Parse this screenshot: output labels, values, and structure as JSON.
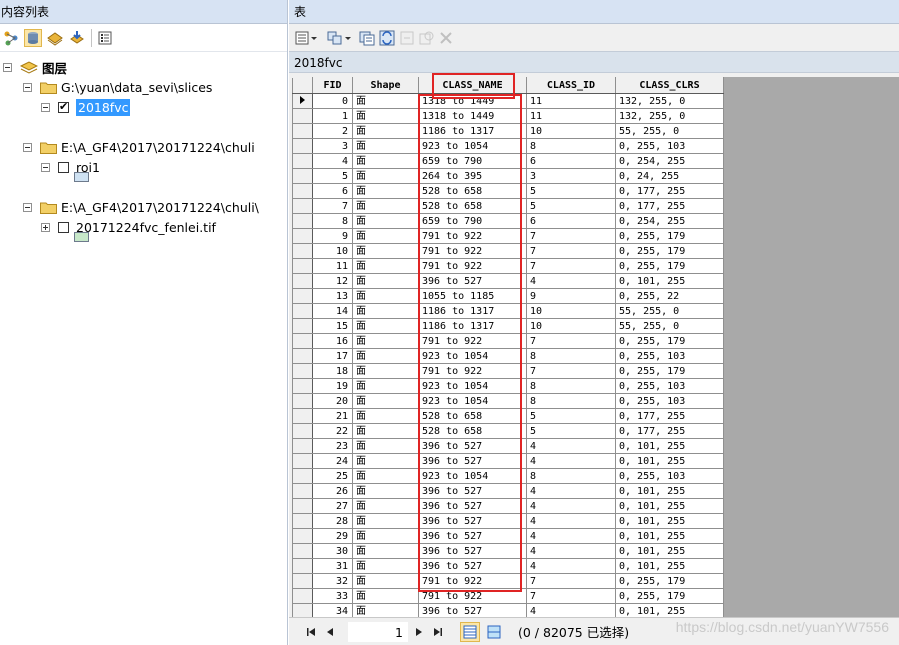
{
  "toc": {
    "title": "内容列表",
    "root_label": "图层",
    "items": [
      {
        "label": "G:\\yuan\\data_sevi\\slices",
        "children": [
          {
            "label": "2018fvc",
            "checked": true,
            "selected": true,
            "swatch": "#cfe2f3"
          }
        ]
      },
      {
        "label": "E:\\A_GF4\\2017\\20171224\\chuli",
        "children": [
          {
            "label": "roi1",
            "checked": false,
            "selected": false,
            "swatch": "#c7e8c9"
          }
        ]
      },
      {
        "label": "E:\\A_GF4\\2017\\20171224\\chuli\\",
        "children": [
          {
            "label": "20171224fvc_fenlei.tif",
            "checked": false,
            "selected": false
          }
        ]
      }
    ]
  },
  "table_window": {
    "title": "表",
    "table_name": "2018fvc",
    "columns": [
      "FID",
      "Shape",
      "CLASS_NAME",
      "CLASS_ID",
      "CLASS_CLRS"
    ],
    "rows": [
      [
        "0",
        "面",
        "1318 to 1449",
        "11",
        "132, 255, 0"
      ],
      [
        "1",
        "面",
        "1318 to 1449",
        "11",
        "132, 255, 0"
      ],
      [
        "2",
        "面",
        "1186 to 1317",
        "10",
        "55, 255, 0"
      ],
      [
        "3",
        "面",
        "923 to 1054",
        "8",
        "0, 255, 103"
      ],
      [
        "4",
        "面",
        "659 to 790",
        "6",
        "0, 254, 255"
      ],
      [
        "5",
        "面",
        "264 to 395",
        "3",
        "0, 24, 255"
      ],
      [
        "6",
        "面",
        "528 to 658",
        "5",
        "0, 177, 255"
      ],
      [
        "7",
        "面",
        "528 to 658",
        "5",
        "0, 177, 255"
      ],
      [
        "8",
        "面",
        "659 to 790",
        "6",
        "0, 254, 255"
      ],
      [
        "9",
        "面",
        "791 to 922",
        "7",
        "0, 255, 179"
      ],
      [
        "10",
        "面",
        "791 to 922",
        "7",
        "0, 255, 179"
      ],
      [
        "11",
        "面",
        "791 to 922",
        "7",
        "0, 255, 179"
      ],
      [
        "12",
        "面",
        "396 to 527",
        "4",
        "0, 101, 255"
      ],
      [
        "13",
        "面",
        "1055 to 1185",
        "9",
        "0, 255, 22"
      ],
      [
        "14",
        "面",
        "1186 to 1317",
        "10",
        "55, 255, 0"
      ],
      [
        "15",
        "面",
        "1186 to 1317",
        "10",
        "55, 255, 0"
      ],
      [
        "16",
        "面",
        "791 to 922",
        "7",
        "0, 255, 179"
      ],
      [
        "17",
        "面",
        "923 to 1054",
        "8",
        "0, 255, 103"
      ],
      [
        "18",
        "面",
        "791 to 922",
        "7",
        "0, 255, 179"
      ],
      [
        "19",
        "面",
        "923 to 1054",
        "8",
        "0, 255, 103"
      ],
      [
        "20",
        "面",
        "923 to 1054",
        "8",
        "0, 255, 103"
      ],
      [
        "21",
        "面",
        "528 to 658",
        "5",
        "0, 177, 255"
      ],
      [
        "22",
        "面",
        "528 to 658",
        "5",
        "0, 177, 255"
      ],
      [
        "23",
        "面",
        "396 to 527",
        "4",
        "0, 101, 255"
      ],
      [
        "24",
        "面",
        "396 to 527",
        "4",
        "0, 101, 255"
      ],
      [
        "25",
        "面",
        "923 to 1054",
        "8",
        "0, 255, 103"
      ],
      [
        "26",
        "面",
        "396 to 527",
        "4",
        "0, 101, 255"
      ],
      [
        "27",
        "面",
        "396 to 527",
        "4",
        "0, 101, 255"
      ],
      [
        "28",
        "面",
        "396 to 527",
        "4",
        "0, 101, 255"
      ],
      [
        "29",
        "面",
        "396 to 527",
        "4",
        "0, 101, 255"
      ],
      [
        "30",
        "面",
        "396 to 527",
        "4",
        "0, 101, 255"
      ],
      [
        "31",
        "面",
        "396 to 527",
        "4",
        "0, 101, 255"
      ],
      [
        "32",
        "面",
        "791 to 922",
        "7",
        "0, 255, 179"
      ],
      [
        "33",
        "面",
        "791 to 922",
        "7",
        "0, 255, 179"
      ],
      [
        "34",
        "面",
        "396 to 527",
        "4",
        "0, 101, 255"
      ]
    ]
  },
  "navigation": {
    "current_record": "1",
    "selection_status": "(0 / 82075 已选择)"
  },
  "watermark": "https://blog.csdn.net/yuanYW7556",
  "colors": {
    "highlight_red": "#e02424",
    "selection_blue": "#3399ff",
    "header_blue": "#d7e3f3"
  }
}
